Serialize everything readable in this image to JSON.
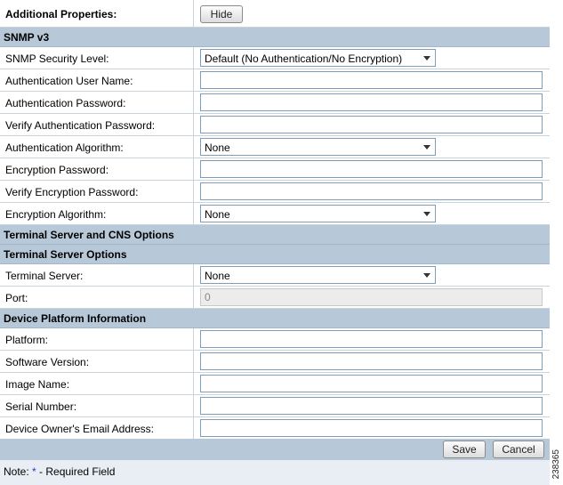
{
  "additional": {
    "label": "Additional Properties:",
    "hide_button": "Hide"
  },
  "snmp": {
    "heading": "SNMP v3",
    "security_level_label": "SNMP Security Level:",
    "security_level_value": "Default (No Authentication/No Encryption)",
    "auth_user_label": "Authentication User Name:",
    "auth_user_value": "",
    "auth_pwd_label": "Authentication Password:",
    "auth_pwd_value": "",
    "verify_auth_pwd_label": "Verify Authentication Password:",
    "verify_auth_pwd_value": "",
    "auth_algo_label": "Authentication Algorithm:",
    "auth_algo_value": "None",
    "enc_pwd_label": "Encryption Password:",
    "enc_pwd_value": "",
    "verify_enc_pwd_label": "Verify Encryption Password:",
    "verify_enc_pwd_value": "",
    "enc_algo_label": "Encryption Algorithm:",
    "enc_algo_value": "None"
  },
  "terminal": {
    "heading": "Terminal Server and CNS Options",
    "subheading": "Terminal Server Options",
    "server_label": "Terminal Server:",
    "server_value": "None",
    "port_label": "Port:",
    "port_value": "0"
  },
  "platform": {
    "heading": "Device Platform Information",
    "platform_label": "Platform:",
    "platform_value": "",
    "software_label": "Software Version:",
    "software_value": "",
    "image_label": "Image Name:",
    "image_value": "",
    "serial_label": "Serial Number:",
    "serial_value": "",
    "email_label": "Device Owner's Email Address:",
    "email_value": ""
  },
  "actions": {
    "save": "Save",
    "cancel": "Cancel"
  },
  "note": {
    "prefix": "Note: ",
    "star": "*",
    "suffix": " - Required Field"
  },
  "figure_id": "238365"
}
